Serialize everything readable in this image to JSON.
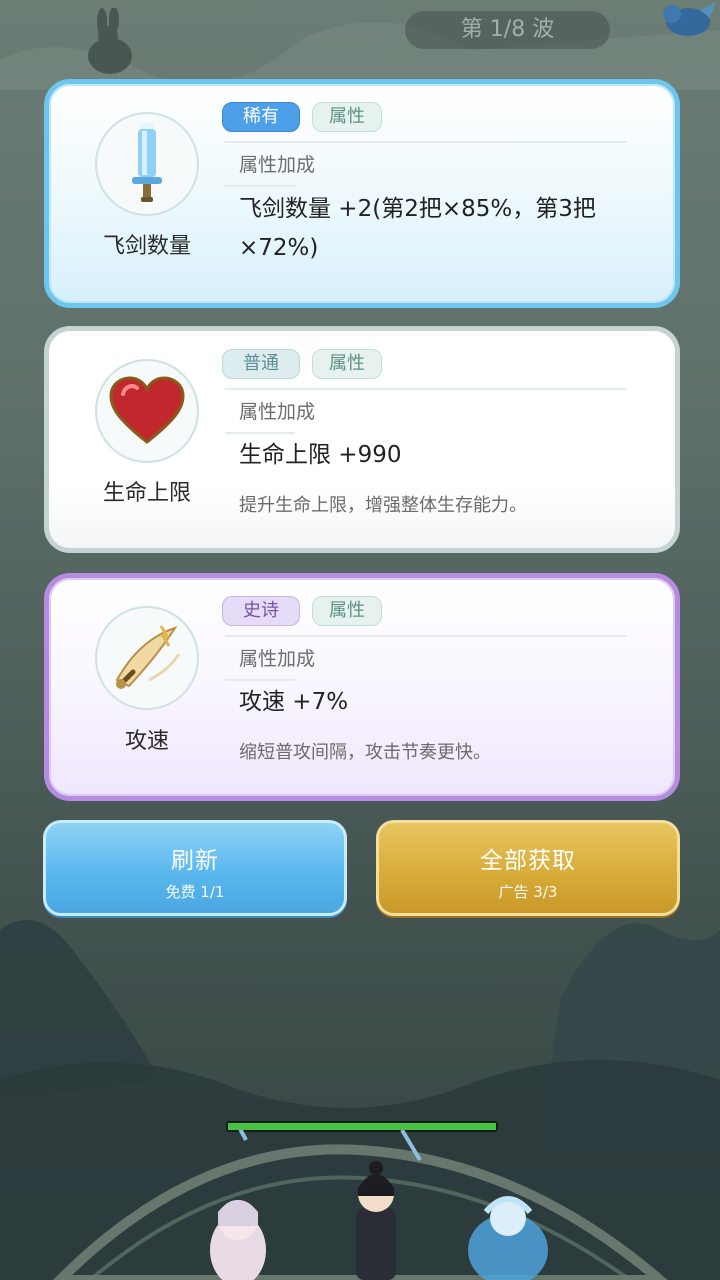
{
  "hud": {
    "wave_text": "第 1/8 波"
  },
  "cards": [
    {
      "rarity": "稀有",
      "kind": "属性",
      "subtitle": "属性加成",
      "name": "飞剑数量",
      "main_line1": "飞剑数量 +2(第2把×85%，第3把",
      "main_line2": "×72%)",
      "icon": "flying-sword-icon"
    },
    {
      "rarity": "普通",
      "kind": "属性",
      "subtitle": "属性加成",
      "name": "生命上限",
      "main": "生命上限 +990",
      "desc": "提升生命上限，增强整体生存能力。",
      "icon": "heart-icon"
    },
    {
      "rarity": "史诗",
      "kind": "属性",
      "subtitle": "属性加成",
      "name": "攻速",
      "main": "攻速 +7%",
      "desc": "缩短普攻间隔，攻击节奏更快。",
      "icon": "sword-slash-icon"
    }
  ],
  "buttons": {
    "refresh": {
      "label": "刷新",
      "sub": "免费 1/1"
    },
    "get_all": {
      "label": "全部获取",
      "sub": "广告 3/3"
    }
  },
  "boss_hp": {
    "fraction": 1.0
  },
  "colors": {
    "rare": "#4d9fe7",
    "common": "#dcecef",
    "epic": "#b68be0",
    "refresh": "#5ab8ee",
    "get_all": "#d7aa36",
    "hp": "#49c145"
  }
}
